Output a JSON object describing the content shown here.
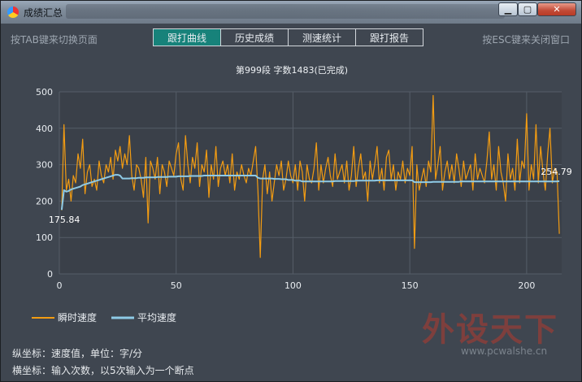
{
  "window": {
    "title": "成绩汇总"
  },
  "hints": {
    "left": "按TAB键来切换页面",
    "right": "按ESC键来关闭窗口"
  },
  "tabs": [
    {
      "label": "跟打曲线",
      "active": true
    },
    {
      "label": "历史成绩",
      "active": false
    },
    {
      "label": "测速统计",
      "active": false
    },
    {
      "label": "跟打报告",
      "active": false
    }
  ],
  "chart_data": {
    "type": "line",
    "title": "第999段 字数1483(已完成)",
    "xlim": [
      0,
      215
    ],
    "ylim": [
      0,
      500
    ],
    "xticks": [
      0,
      50,
      100,
      150,
      200
    ],
    "yticks": [
      0,
      100,
      200,
      300,
      400,
      500
    ],
    "grid": true,
    "legend_placement": "bottom-left",
    "series": [
      {
        "name": "瞬时速度",
        "color": "#f39c12",
        "values": [
          175,
          410,
          230,
          260,
          200,
          270,
          250,
          330,
          290,
          370,
          220,
          280,
          300,
          240,
          260,
          230,
          310,
          270,
          250,
          300,
          280,
          320,
          260,
          340,
          310,
          350,
          290,
          330,
          300,
          380,
          270,
          230,
          300,
          290,
          260,
          210,
          320,
          140,
          310,
          290,
          260,
          320,
          220,
          300,
          280,
          240,
          310,
          290,
          270,
          330,
          360,
          260,
          230,
          380,
          300,
          250,
          320,
          290,
          360,
          240,
          300,
          280,
          340,
          210,
          300,
          260,
          350,
          240,
          290,
          310,
          270,
          300,
          250,
          330,
          230,
          280,
          260,
          300,
          270,
          250,
          290,
          270,
          310,
          350,
          230,
          45,
          260,
          300,
          220,
          280,
          200,
          250,
          300,
          270,
          310,
          230,
          260,
          310,
          270,
          250,
          300,
          230,
          310,
          280,
          200,
          300,
          260,
          250,
          290,
          360,
          230,
          300,
          250,
          290,
          320,
          270,
          240,
          330,
          260,
          280,
          300,
          250,
          310,
          230,
          270,
          350,
          240,
          290,
          330,
          260,
          280,
          200,
          310,
          260,
          300,
          350,
          250,
          290,
          230,
          320,
          340,
          260,
          300,
          230,
          280,
          260,
          310,
          250,
          290,
          270,
          350,
          70,
          300,
          230,
          260,
          290,
          240,
          310,
          280,
          490,
          260,
          300,
          350,
          230,
          280,
          310,
          260,
          300,
          250,
          330,
          290,
          240,
          310,
          260,
          280,
          300,
          230,
          330,
          260,
          290,
          270,
          250,
          310,
          390,
          260,
          300,
          230,
          350,
          280,
          250,
          200,
          330,
          260,
          290,
          230,
          370,
          250,
          310,
          290,
          440,
          230,
          300,
          260,
          410,
          250,
          350,
          280,
          230,
          330,
          400,
          250,
          290,
          280,
          110
        ],
        "end_label": ""
      },
      {
        "name": "平均速度",
        "color": "#8ecae6",
        "values": [
          175.84,
          230,
          226,
          228,
          232,
          234,
          236,
          238,
          240,
          244,
          246,
          248,
          250,
          252,
          254,
          256,
          258,
          260,
          262,
          264,
          266,
          268,
          270,
          272,
          272,
          270,
          262,
          262,
          262,
          262,
          263,
          263,
          263,
          264,
          264,
          264,
          265,
          265,
          265,
          265,
          265,
          266,
          266,
          266,
          266,
          266,
          267,
          267,
          267,
          267,
          268,
          268,
          268,
          268,
          268,
          269,
          269,
          269,
          269,
          269,
          269,
          270,
          270,
          270,
          270,
          270,
          270,
          270,
          270,
          270,
          270,
          270,
          270,
          270,
          270,
          270,
          270,
          270,
          270,
          270,
          270,
          270,
          270,
          270,
          264,
          262,
          262,
          262,
          262,
          262,
          262,
          261,
          261,
          261,
          260,
          260,
          260,
          258,
          258,
          258,
          256,
          256,
          256,
          254,
          254,
          254,
          254,
          254,
          254,
          254,
          254,
          254,
          254,
          254,
          254,
          254,
          254,
          255,
          255,
          255,
          255,
          255,
          255,
          255,
          255,
          255,
          256,
          256,
          256,
          256,
          256,
          256,
          256,
          256,
          256,
          257,
          257,
          257,
          257,
          257,
          257,
          257,
          257,
          257,
          257,
          257,
          257,
          257,
          257,
          257,
          257,
          252,
          252,
          252,
          252,
          252,
          252,
          252,
          252,
          253,
          253,
          253,
          253,
          253,
          253,
          253,
          253,
          253,
          253,
          253,
          253,
          254,
          254,
          254,
          254,
          254,
          254,
          254,
          254,
          254,
          254,
          254,
          254,
          254,
          254,
          254,
          254,
          254,
          254,
          254,
          254,
          254,
          254,
          254,
          254,
          254,
          254,
          254,
          254,
          254,
          254,
          254,
          254,
          254,
          254,
          254,
          254,
          254,
          254,
          254,
          254,
          254,
          254,
          254.79
        ],
        "start_label": "175.84",
        "end_label": "254.79"
      }
    ]
  },
  "footer": {
    "y_axis_note": "纵坐标：速度值，单位：字/分",
    "x_axis_note": "横坐标：输入次数，以5次输入为一个断点"
  },
  "watermark": {
    "main": "外设天下",
    "url": "www.pcwalshe.cn"
  }
}
